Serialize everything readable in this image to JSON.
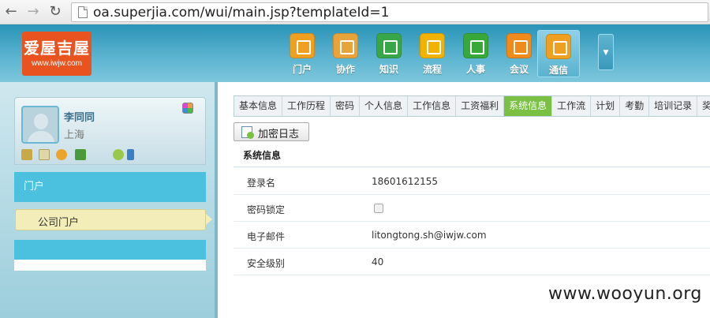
{
  "browser": {
    "url": "oa.superjia.com/wui/main.jsp?templateId=1"
  },
  "header": {
    "logo_main": "爱屋吉屋",
    "logo_sub": "www.iwjw.com",
    "modules": [
      {
        "label": "门户",
        "icon": "home-icon",
        "color": "#f0a020"
      },
      {
        "label": "协作",
        "icon": "clipboard-icon",
        "color": "#e8a33b"
      },
      {
        "label": "知识",
        "icon": "server-icon",
        "color": "#3aa64a"
      },
      {
        "label": "流程",
        "icon": "bar-chart-icon",
        "color": "#f2b300"
      },
      {
        "label": "人事",
        "icon": "id-card-icon",
        "color": "#39a83a"
      },
      {
        "label": "会议",
        "icon": "phone-icon",
        "color": "#f08a1a"
      },
      {
        "label": "通信",
        "icon": "mobile-icon",
        "color": "#f0a020",
        "active": true
      }
    ]
  },
  "sidebar": {
    "user_name": "李同同",
    "user_city": "上海",
    "portal_label": "门户",
    "company_portal_label": "公司门户"
  },
  "main": {
    "tabs": [
      "基本信息",
      "工作历程",
      "密码",
      "个人信息",
      "工作信息",
      "工资福利",
      "系统信息",
      "工作流",
      "计划",
      "考勤",
      "培训记录",
      "奖"
    ],
    "active_tab": "系统信息",
    "log_button": "加密日志",
    "section_title": "系统信息",
    "rows": [
      {
        "label": "登录名",
        "value": "18601612155"
      },
      {
        "label": "密码锁定",
        "value": ""
      },
      {
        "label": "电子邮件",
        "value": "litongtong.sh@iwjw.com"
      },
      {
        "label": "安全级别",
        "value": "40"
      }
    ]
  },
  "watermark": "www.wooyun.org"
}
